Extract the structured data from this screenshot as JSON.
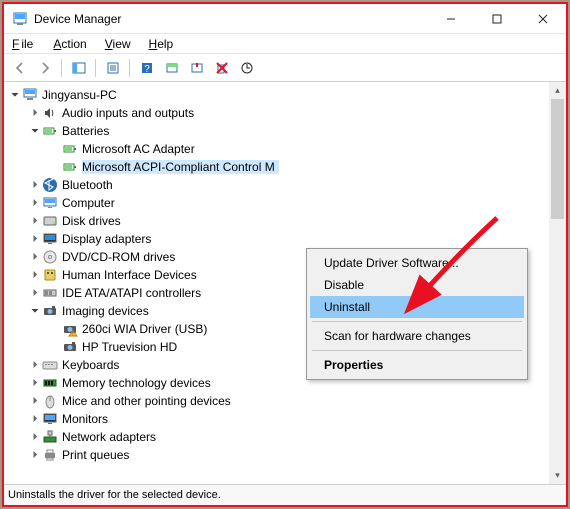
{
  "title": "Device Manager",
  "menu": {
    "file": "File",
    "action": "Action",
    "view": "View",
    "help": "Help"
  },
  "tree": {
    "root": "Jingyansu-PC",
    "nodes": [
      {
        "label": "Audio inputs and outputs",
        "icon": "speaker"
      },
      {
        "label": "Batteries",
        "icon": "battery",
        "expanded": true,
        "children": [
          {
            "label": "Microsoft AC Adapter",
            "icon": "battery"
          },
          {
            "label": "Microsoft ACPI-Compliant Control M",
            "icon": "battery",
            "selected": true
          }
        ]
      },
      {
        "label": "Bluetooth",
        "icon": "bluetooth"
      },
      {
        "label": "Computer",
        "icon": "computer"
      },
      {
        "label": "Disk drives",
        "icon": "disk"
      },
      {
        "label": "Display adapters",
        "icon": "display"
      },
      {
        "label": "DVD/CD-ROM drives",
        "icon": "cd"
      },
      {
        "label": "Human Interface Devices",
        "icon": "hid"
      },
      {
        "label": "IDE ATA/ATAPI controllers",
        "icon": "ide"
      },
      {
        "label": "Imaging devices",
        "icon": "camera",
        "expanded": true,
        "children": [
          {
            "label": "260ci WIA Driver (USB)",
            "icon": "camera-warn"
          },
          {
            "label": "HP Truevision HD",
            "icon": "camera"
          }
        ]
      },
      {
        "label": "Keyboards",
        "icon": "keyboard"
      },
      {
        "label": "Memory technology devices",
        "icon": "memory"
      },
      {
        "label": "Mice and other pointing devices",
        "icon": "mouse"
      },
      {
        "label": "Monitors",
        "icon": "monitor"
      },
      {
        "label": "Network adapters",
        "icon": "network"
      },
      {
        "label": "Print queues",
        "icon": "printer"
      }
    ]
  },
  "context_menu": {
    "items": [
      {
        "label": "Update Driver Software..."
      },
      {
        "label": "Disable"
      },
      {
        "label": "Uninstall",
        "highlighted": true
      },
      {
        "sep": true
      },
      {
        "label": "Scan for hardware changes"
      },
      {
        "sep": true
      },
      {
        "label": "Properties",
        "bold": true
      }
    ]
  },
  "status": "Uninstalls the driver for the selected device."
}
